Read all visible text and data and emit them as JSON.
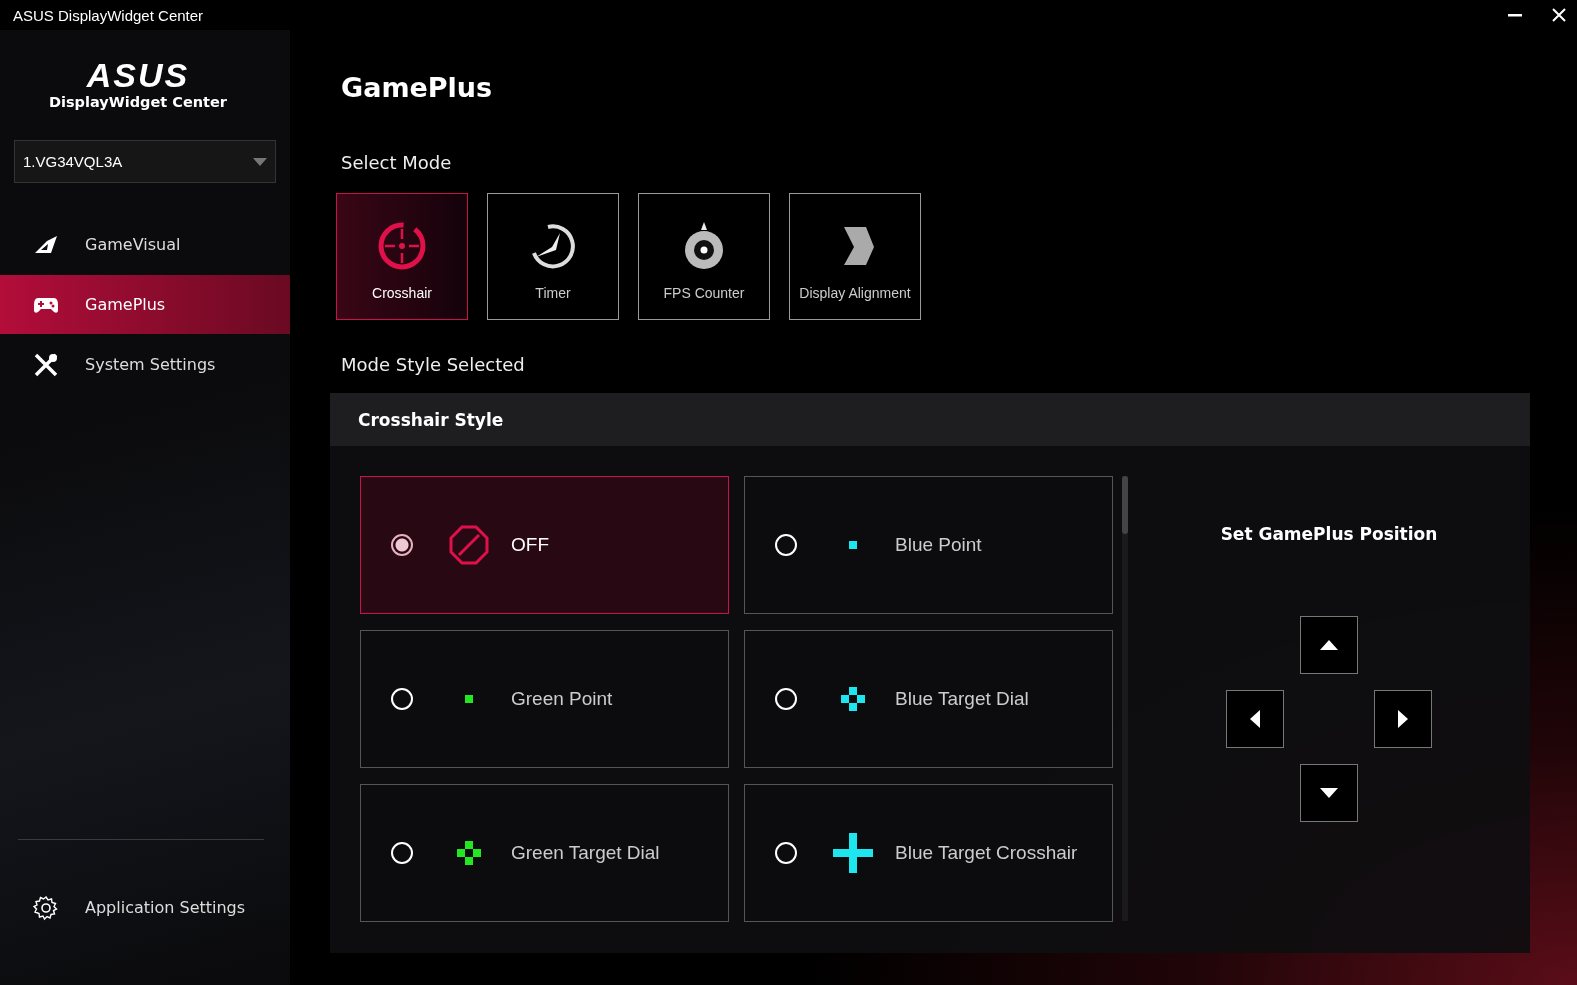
{
  "window": {
    "title": "ASUS DisplayWidget Center"
  },
  "sidebar": {
    "logo": "ASUS",
    "app_name": "DisplayWidget Center",
    "monitor_select": {
      "value": "1.VG34VQL3A"
    },
    "items": [
      {
        "label": "GameVisual",
        "kind": "visual",
        "selected": false
      },
      {
        "label": "GamePlus",
        "kind": "gamepad",
        "selected": true
      },
      {
        "label": "System Settings",
        "kind": "tools",
        "selected": false
      }
    ],
    "footer_item": {
      "label": "Application Settings"
    }
  },
  "page": {
    "title": "GamePlus",
    "select_mode_label": "Select Mode",
    "modes": [
      {
        "label": "Crosshair",
        "kind": "crosshair",
        "selected": true
      },
      {
        "label": "Timer",
        "kind": "timer",
        "selected": false
      },
      {
        "label": "FPS Counter",
        "kind": "fps",
        "selected": false
      },
      {
        "label": "Display Alignment",
        "kind": "alignment",
        "selected": false
      }
    ],
    "mode_style_label": "Mode Style Selected",
    "style_panel": {
      "title": "Crosshair Style",
      "styles": [
        {
          "label": "OFF",
          "kind": "off",
          "color": "#e0104a",
          "selected": true
        },
        {
          "label": "Blue Point",
          "kind": "point",
          "color": "#1ee6ee",
          "selected": false
        },
        {
          "label": "Green Point",
          "kind": "point",
          "color": "#22e822",
          "selected": false
        },
        {
          "label": "Blue Target Dial",
          "kind": "dial",
          "color": "#1ee6ee",
          "selected": false
        },
        {
          "label": "Green Target Dial",
          "kind": "dial",
          "color": "#22e822",
          "selected": false
        },
        {
          "label": "Blue Target Crosshair",
          "kind": "crosshair",
          "color": "#1ee6ee",
          "selected": false
        }
      ],
      "position": {
        "title": "Set GamePlus Position",
        "buttons": [
          {
            "kind": "up"
          },
          {
            "kind": "left"
          },
          {
            "kind": "right"
          },
          {
            "kind": "down"
          }
        ]
      }
    }
  }
}
